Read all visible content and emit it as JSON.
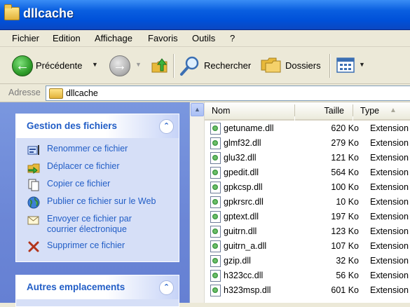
{
  "window": {
    "title": "dllcache"
  },
  "menu": [
    "Fichier",
    "Edition",
    "Affichage",
    "Favoris",
    "Outils",
    "?"
  ],
  "toolbar": {
    "back_label": "Précédente",
    "search_label": "Rechercher",
    "folders_label": "Dossiers"
  },
  "address": {
    "label": "Adresse",
    "value": "dllcache"
  },
  "tasks_panel": {
    "title": "Gestion des fichiers",
    "items": [
      {
        "label": "Renommer ce fichier",
        "icon": "rename-icon"
      },
      {
        "label": "Déplacer ce fichier",
        "icon": "move-icon"
      },
      {
        "label": "Copier ce fichier",
        "icon": "copy-icon"
      },
      {
        "label": "Publier ce fichier sur le Web",
        "icon": "globe-icon"
      },
      {
        "label": "Envoyer ce fichier par courrier électronique",
        "line1": "Envoyer ce fichier par",
        "line2": "courrier électronique",
        "icon": "email-icon"
      },
      {
        "label": "Supprimer ce fichier",
        "icon": "delete-icon"
      }
    ]
  },
  "places_panel": {
    "title": "Autres emplacements"
  },
  "filelist": {
    "columns": {
      "name": "Nom",
      "size": "Taille",
      "type": "Type"
    },
    "rows": [
      {
        "name": "getuname.dll",
        "size": "620 Ko",
        "type": "Extension de"
      },
      {
        "name": "glmf32.dll",
        "size": "279 Ko",
        "type": "Extension de"
      },
      {
        "name": "glu32.dll",
        "size": "121 Ko",
        "type": "Extension de"
      },
      {
        "name": "gpedit.dll",
        "size": "564 Ko",
        "type": "Extension de"
      },
      {
        "name": "gpkcsp.dll",
        "size": "100 Ko",
        "type": "Extension de"
      },
      {
        "name": "gpkrsrc.dll",
        "size": "10 Ko",
        "type": "Extension de"
      },
      {
        "name": "gptext.dll",
        "size": "197 Ko",
        "type": "Extension de"
      },
      {
        "name": "guitrn.dll",
        "size": "123 Ko",
        "type": "Extension de"
      },
      {
        "name": "guitrn_a.dll",
        "size": "107 Ko",
        "type": "Extension de"
      },
      {
        "name": "gzip.dll",
        "size": "32 Ko",
        "type": "Extension de"
      },
      {
        "name": "h323cc.dll",
        "size": "56 Ko",
        "type": "Extension de"
      },
      {
        "name": "h323msp.dll",
        "size": "601 Ko",
        "type": "Extension de"
      }
    ]
  },
  "colors": {
    "titlebar": "#0050d8",
    "task_link": "#215dc6",
    "taskpane_bg": "#6b86d6"
  }
}
